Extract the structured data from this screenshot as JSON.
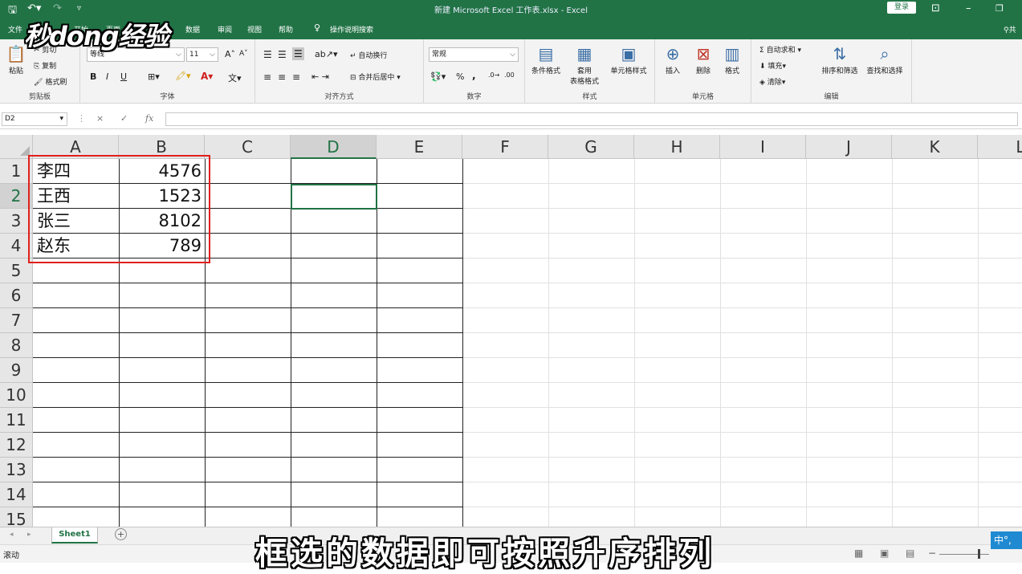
{
  "window": {
    "title": "新建 Microsoft Excel 工作表.xlsx - Excel",
    "login": "登录"
  },
  "watermark": "秒dong经验",
  "tabs": [
    "文件",
    "开始",
    "页面",
    "数据",
    "审阅",
    "视图",
    "帮助",
    "操作说明搜索"
  ],
  "share": "共",
  "ribbon": {
    "clipboard": {
      "paste": "粘贴",
      "cut": "剪切",
      "copy": "复制",
      "format_painter": "格式刷",
      "label": "剪贴板"
    },
    "font": {
      "name": "等线",
      "size": "11",
      "grow": "A",
      "shrink": "A",
      "bold": "B",
      "italic": "I",
      "underline": "U",
      "label": "字体"
    },
    "align": {
      "wrap": "自动换行",
      "merge": "合并后居中",
      "label": "对齐方式"
    },
    "number": {
      "format": "常规",
      "percent": "%",
      "comma": ",",
      "label": "数字"
    },
    "styles": {
      "cond": "条件格式",
      "table1": "套用",
      "table2": "表格格式",
      "cell": "单元格样式",
      "label": "样式"
    },
    "cells": {
      "insert": "插入",
      "delete": "删除",
      "format": "格式",
      "label": "单元格"
    },
    "editing": {
      "autosum": "自动求和",
      "fill": "填充",
      "clear": "清除",
      "sort": "排序和筛选",
      "find": "查找和选择",
      "label": "编辑"
    }
  },
  "formula_bar": {
    "namebox": "D2",
    "cancel": "×",
    "enter": "✓",
    "fx": "fx",
    "value": ""
  },
  "columns": [
    "A",
    "B",
    "C",
    "D",
    "E",
    "F",
    "G",
    "H",
    "I",
    "J",
    "K",
    "L"
  ],
  "rows": [
    "1",
    "2",
    "3",
    "4",
    "5",
    "6",
    "7",
    "8",
    "9",
    "10",
    "11",
    "12",
    "13",
    "14",
    "15"
  ],
  "cells": [
    {
      "name": "李四",
      "value": "4576"
    },
    {
      "name": "王西",
      "value": "1523"
    },
    {
      "name": "张三",
      "value": "8102"
    },
    {
      "name": "赵东",
      "value": "789"
    }
  ],
  "selected_cell": "D2",
  "sheets": [
    "Sheet1"
  ],
  "add_sheet": "+",
  "status": {
    "mode": "滚动",
    "zoom_minus": "−"
  },
  "ime": "中°,",
  "subtitle": "框选的数据即可按照升序排列"
}
